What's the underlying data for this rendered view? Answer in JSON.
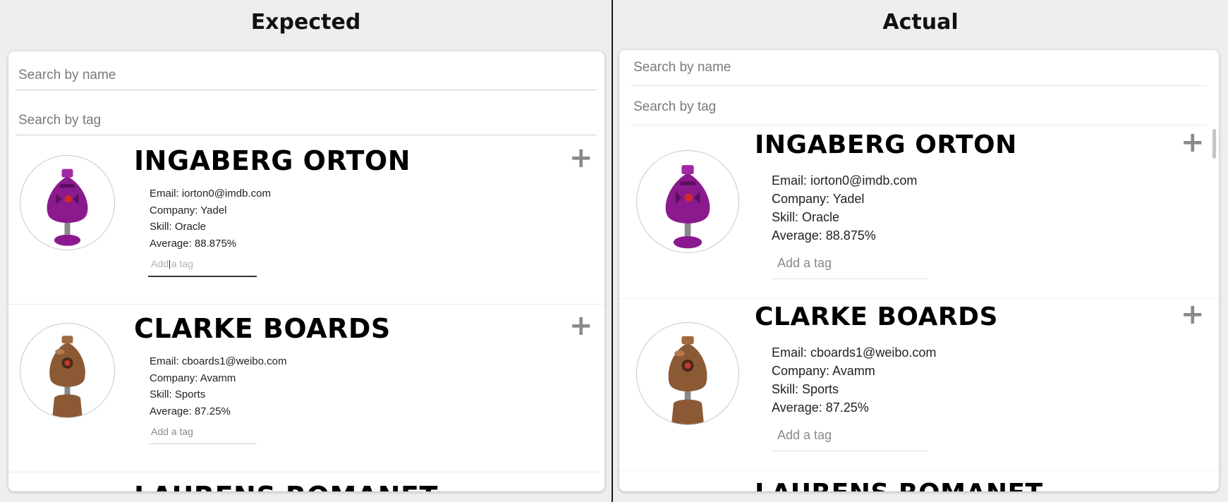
{
  "panes": {
    "expected": {
      "title": "Expected"
    },
    "actual": {
      "title": "Actual"
    }
  },
  "search": {
    "name_placeholder": "Search by name",
    "tag_placeholder": "Search by tag"
  },
  "students": [
    {
      "name": "INGABERG ORTON",
      "email": "Email: iorton0@imdb.com",
      "company": "Company: Yadel",
      "skill": "Skill: Oracle",
      "average": "Average: 88.875%",
      "tag_placeholder": "Add a tag",
      "expand_label": "+",
      "avatar_color": "#8a1a8e"
    },
    {
      "name": "CLARKE BOARDS",
      "email": "Email: cboards1@weibo.com",
      "company": "Company: Avamm",
      "skill": "Skill: Sports",
      "average": "Average: 87.25%",
      "tag_placeholder": "Add a tag",
      "expand_label": "+",
      "avatar_color": "#8b5a35"
    },
    {
      "name": "LAURENS ROMANET"
    }
  ],
  "colors": {
    "background": "#eeeeee",
    "card": "#ffffff",
    "plus": "#8a8a8a"
  }
}
